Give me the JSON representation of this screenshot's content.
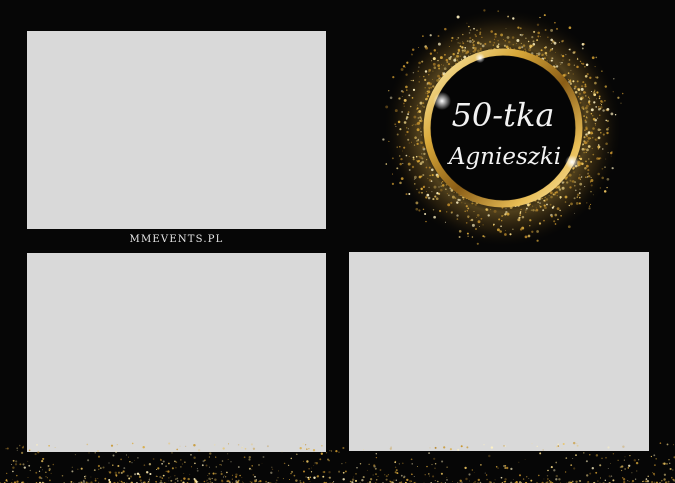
{
  "badge": {
    "line1": "50-tka",
    "line2": "Agnieszki"
  },
  "watermark": "MMEVENTS.PL",
  "colors": {
    "background": "#060606",
    "photo_placeholder": "#d9d9d9",
    "gold": "#d4a93c",
    "gold_light": "#f6dc8a",
    "text_light": "#f2f2f2"
  }
}
